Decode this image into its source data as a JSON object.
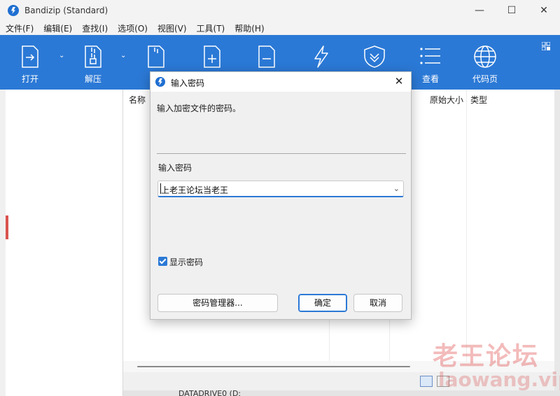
{
  "window": {
    "title": "Bandizip (Standard)",
    "minimize": "—",
    "maximize": "☐",
    "close": "✕"
  },
  "menu": [
    "文件(F)",
    "编辑(E)",
    "查找(I)",
    "选项(O)",
    "视图(V)",
    "工具(T)",
    "帮助(H)"
  ],
  "toolbar": {
    "open_label": "打开",
    "extract_label": "解压",
    "view_label": "查看",
    "codepage_label": "代码页"
  },
  "list": {
    "columns": [
      "名称",
      "原始大小",
      "类型"
    ]
  },
  "statusbar": {
    "drive_label": "DATADRIVE0 (D:"
  },
  "watermark": {
    "text": "老王论坛",
    "url": "laowang.vip"
  },
  "dialog": {
    "title": "输入密码",
    "message": "输入加密文件的密码。",
    "field_label": "输入密码",
    "password_value": "上老王论坛当老王",
    "show_password_label": "显示密码",
    "show_password_checked": true,
    "manager_button": "密码管理器...",
    "ok_button": "确定",
    "cancel_button": "取消"
  },
  "colors": {
    "accent": "#2b79d6",
    "toolbar_bg": "#2b79d6"
  }
}
